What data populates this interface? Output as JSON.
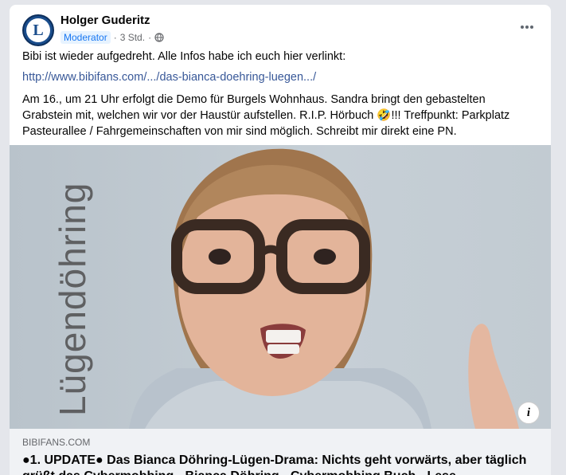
{
  "post": {
    "author": "Holger Guderitz",
    "role": "Moderator",
    "time": "3 Std.",
    "separator": "·",
    "more_icon": "more-dots-icon",
    "body_intro": "Bibi ist wieder aufgedreht. Alle Infos habe ich euch hier verlinkt:",
    "link_text": "http://www.bibifans.com/.../das-bianca-doehring-luegen.../",
    "body_main_1": "Am 16., um 21 Uhr erfolgt die Demo für Burgels Wohnhaus. Sandra bringt den gebastelten Grabstein mit, welchen wir vor der Haustür aufstellen. R.I.P. Hörbuch ",
    "emoji": "🤣",
    "body_main_2": "!!! Treffpunkt: Parkplatz Pasteurallee / Fahrgemeinschaften von mir sind möglich. Schreibt mir direkt eine PN."
  },
  "preview": {
    "image_text": "Lügendöhring",
    "domain": "BIBIFANS.COM",
    "title": "●1. UPDATE● Das Bianca Döhring-Lügen-Drama: Nichts geht vorwärts, aber täglich grüßt das Cybermobbing - Bianca Döhring - Cybermobbing Buch - Lese",
    "info_label": "i"
  },
  "colors": {
    "accent": "#1877f2",
    "link": "#385898",
    "avatar": "#1a4d8c"
  }
}
